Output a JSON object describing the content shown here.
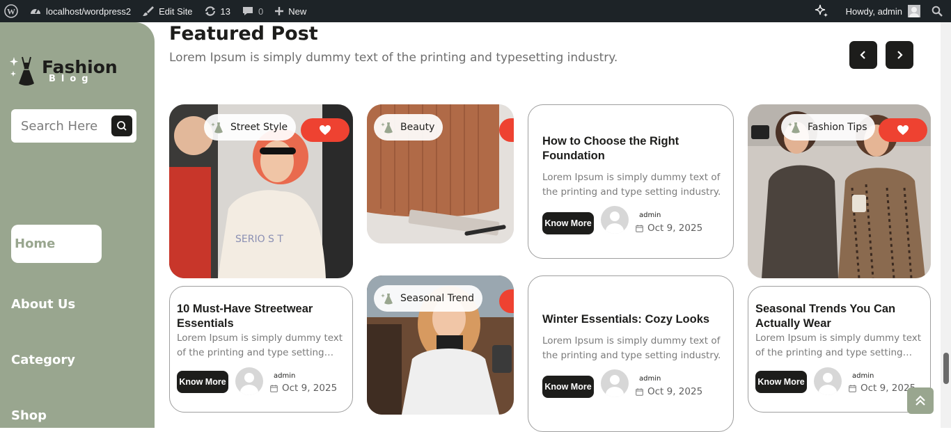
{
  "adminbar": {
    "site_label": "localhost/wordpress2",
    "edit_label": "Edit Site",
    "updates_count": "13",
    "comments_count": "0",
    "new_label": "New",
    "howdy_label": "Howdy, admin"
  },
  "sidebar": {
    "logo_title": "Fashion",
    "logo_sub": "Blog",
    "search_placeholder": "Search Here",
    "nav": [
      "Home",
      "About Us",
      "Category",
      "Shop"
    ]
  },
  "main": {
    "title": "Featured Post",
    "subtitle": "Lorem Ipsum is simply dummy text of the printing and typesetting industry."
  },
  "cards": {
    "street_tag": "Street Style",
    "beauty_tag": "Beauty",
    "seasonal_tag": "Seasonal Trend",
    "tips_tag": "Fashion Tips",
    "post1": {
      "title": "How to Choose the Right Foundation",
      "desc": "Lorem Ipsum is simply dummy text of the printing and type setting industry.",
      "author": "admin",
      "date": "Oct 9, 2025",
      "button": "Know More"
    },
    "post2": {
      "title": "10 Must-Have Streetwear Essentials",
      "desc": "Lorem Ipsum is simply dummy text of the printing and type setting…",
      "author": "admin",
      "date": "Oct 9, 2025",
      "button": "Know More"
    },
    "post3": {
      "title": "Winter Essentials: Cozy Looks",
      "desc": "Lorem Ipsum is simply dummy text of the printing and type setting industry.",
      "author": "admin",
      "date": "Oct 9, 2025",
      "button": "Know More"
    },
    "post4": {
      "title": "Seasonal Trends You Can Actually Wear",
      "desc": "Lorem Ipsum is simply dummy text of the printing and type setting…",
      "author": "admin",
      "date": "Oct 9, 2025",
      "button": "Know More"
    }
  },
  "colors": {
    "sage": "#99a68f",
    "dark": "#1d1d1b",
    "heart": "#ee4231",
    "adminbar": "#1d2327"
  }
}
